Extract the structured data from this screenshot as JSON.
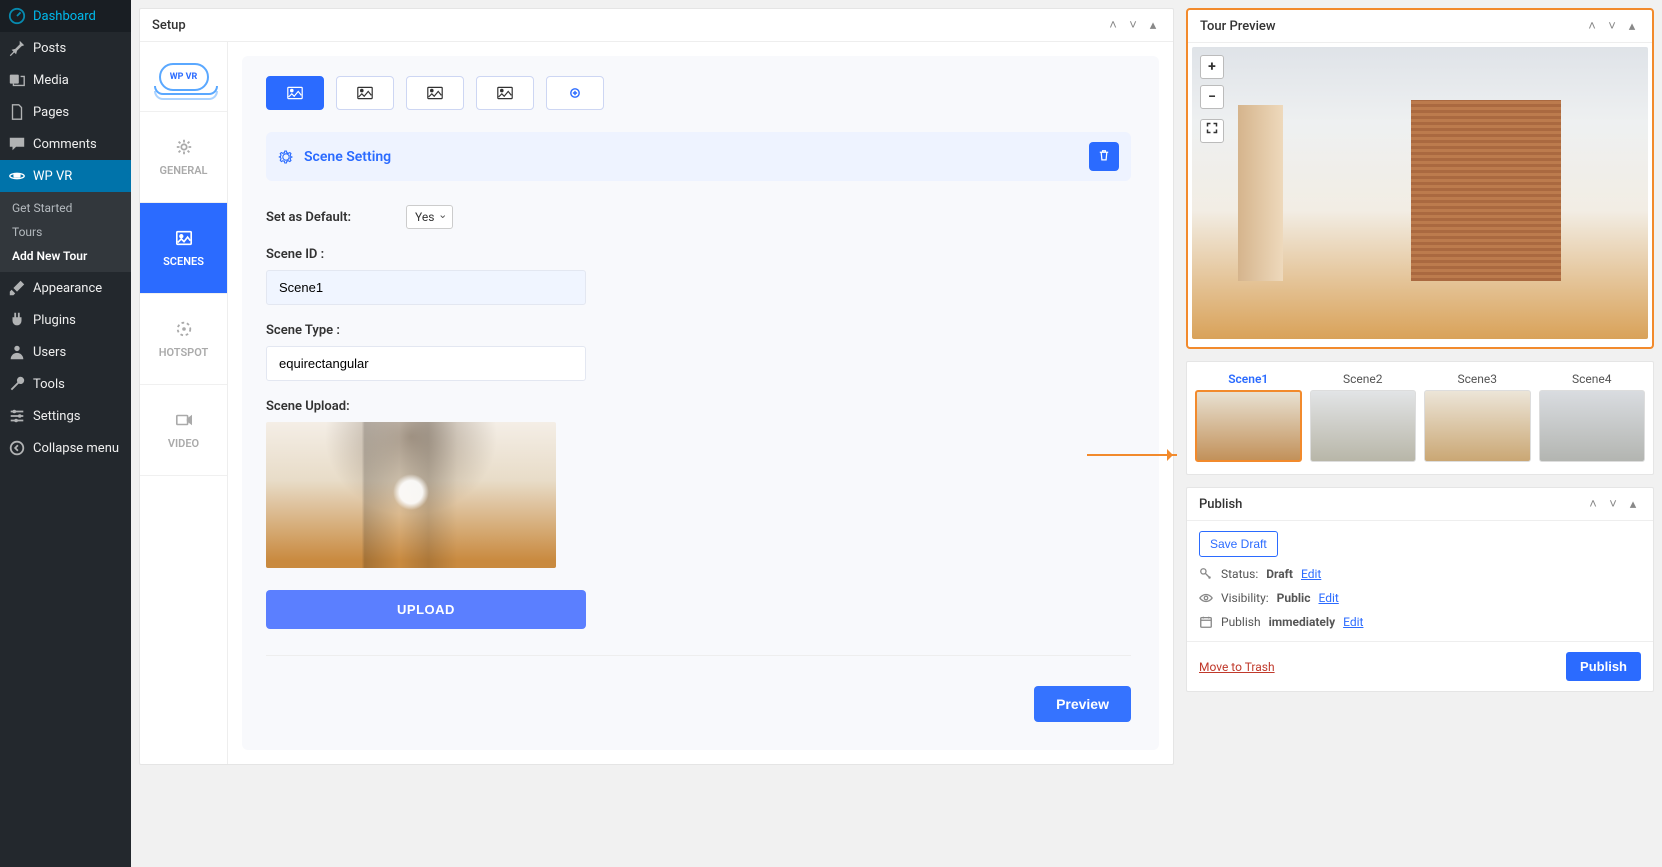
{
  "sidebar": {
    "items": [
      {
        "label": "Dashboard",
        "icon": "dashboard"
      },
      {
        "label": "Posts",
        "icon": "pin"
      },
      {
        "label": "Media",
        "icon": "media"
      },
      {
        "label": "Pages",
        "icon": "page"
      },
      {
        "label": "Comments",
        "icon": "comment"
      },
      {
        "label": "WP VR",
        "icon": "wpvr",
        "active": true
      },
      {
        "label": "Appearance",
        "icon": "brush"
      },
      {
        "label": "Plugins",
        "icon": "plug"
      },
      {
        "label": "Users",
        "icon": "user"
      },
      {
        "label": "Tools",
        "icon": "wrench"
      },
      {
        "label": "Settings",
        "icon": "sliders"
      },
      {
        "label": "Collapse menu",
        "icon": "collapse"
      }
    ],
    "sub": [
      {
        "label": "Get Started"
      },
      {
        "label": "Tours"
      },
      {
        "label": "Add New Tour",
        "active": true
      }
    ]
  },
  "setup": {
    "title": "Setup",
    "vtabs": [
      {
        "label": "GENERAL",
        "icon": "gear"
      },
      {
        "label": "SCENES",
        "icon": "image",
        "active": true
      },
      {
        "label": "HOTSPOT",
        "icon": "target"
      },
      {
        "label": "VIDEO",
        "icon": "video"
      }
    ],
    "section_title": "Scene Setting",
    "default_label": "Set as Default:",
    "default_value": "Yes",
    "scene_id_label": "Scene ID :",
    "scene_id_value": "Scene1",
    "scene_type_label": "Scene Type :",
    "scene_type_value": "equirectangular",
    "scene_upload_label": "Scene Upload:",
    "upload_btn": "UPLOAD",
    "preview_btn": "Preview",
    "logo_text": "WP VR"
  },
  "tour_preview": {
    "title": "Tour Preview",
    "zoom_in": "+",
    "zoom_out": "−",
    "fullscreen": "⛶",
    "thumbs": [
      {
        "label": "Scene1",
        "active": true
      },
      {
        "label": "Scene2"
      },
      {
        "label": "Scene3"
      },
      {
        "label": "Scene4"
      }
    ]
  },
  "publish": {
    "title": "Publish",
    "save_draft": "Save Draft",
    "status_label": "Status:",
    "status_value": "Draft",
    "status_edit": "Edit",
    "visibility_label": "Visibility:",
    "visibility_value": "Public",
    "visibility_edit": "Edit",
    "pub_label": "Publish",
    "pub_value": "immediately",
    "pub_edit": "Edit",
    "trash": "Move to Trash",
    "publish_btn": "Publish"
  }
}
